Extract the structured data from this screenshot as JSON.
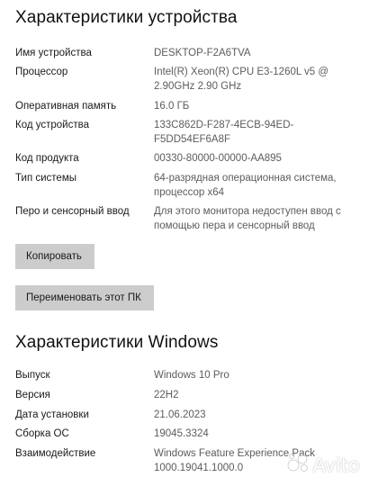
{
  "device": {
    "title": "Характеристики устройства",
    "rows": [
      {
        "label": "Имя устройства",
        "value": "DESKTOP-F2A6TVA"
      },
      {
        "label": "Процессор",
        "value": "Intel(R) Xeon(R) CPU E3-1260L v5 @ 2.90GHz   2.90 GHz"
      },
      {
        "label": "Оперативная память",
        "value": "16.0 ГБ"
      },
      {
        "label": "Код устройства",
        "value": "133C862D-F287-4ECB-94ED-F5DD54EF6A8F"
      },
      {
        "label": "Код продукта",
        "value": "00330-80000-00000-AA895"
      },
      {
        "label": "Тип системы",
        "value": "64-разрядная операционная система, процессор x64"
      },
      {
        "label": "Перо и сенсорный ввод",
        "value": "Для этого монитора недоступен ввод с помощью пера и сенсорный ввод"
      }
    ],
    "copy_button": "Копировать",
    "rename_button": "Переименовать этот ПК"
  },
  "windows": {
    "title": "Характеристики Windows",
    "rows": [
      {
        "label": "Выпуск",
        "value": "Windows 10 Pro"
      },
      {
        "label": "Версия",
        "value": "22H2"
      },
      {
        "label": "Дата установки",
        "value": "21.06.2023"
      },
      {
        "label": "Сборка ОС",
        "value": "19045.3324"
      },
      {
        "label": "Взаимодействие",
        "value": "Windows Feature Experience Pack 1000.19041.1000.0"
      }
    ]
  },
  "watermark": {
    "text": "Avito",
    "icon": "avito-logo-icon"
  }
}
